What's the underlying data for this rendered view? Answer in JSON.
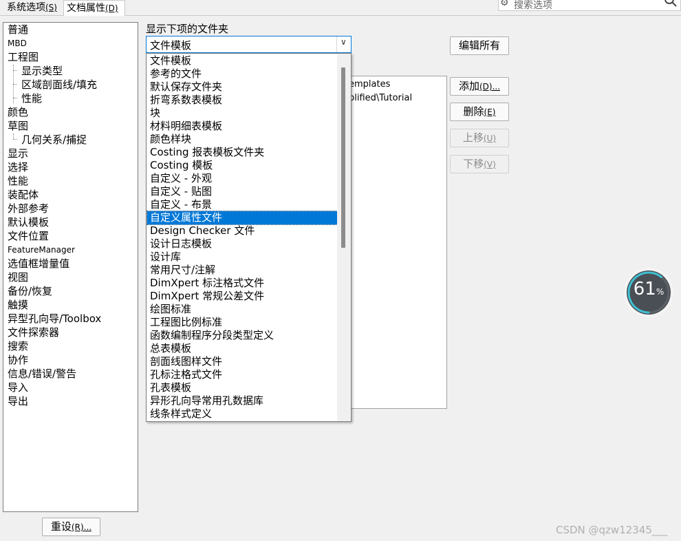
{
  "tabs": [
    {
      "label": "系统选项",
      "accel": "(S)"
    },
    {
      "label": "文档属性",
      "accel": "(D)"
    }
  ],
  "search": {
    "placeholder": "搜索选项"
  },
  "tree": {
    "items": [
      {
        "label": "普通"
      },
      {
        "label": "MBD"
      },
      {
        "label": "工程图"
      },
      {
        "label": "显示类型"
      },
      {
        "label": "区域剖面线/填充"
      },
      {
        "label": "性能"
      },
      {
        "label": "颜色"
      },
      {
        "label": "草图"
      },
      {
        "label": "几何关系/捕捉"
      },
      {
        "label": "显示"
      },
      {
        "label": "选择"
      },
      {
        "label": "性能"
      },
      {
        "label": "装配体"
      },
      {
        "label": "外部参考"
      },
      {
        "label": "默认模板"
      },
      {
        "label": "文件位置"
      },
      {
        "label": "FeatureManager"
      },
      {
        "label": "选值框增量值"
      },
      {
        "label": "视图"
      },
      {
        "label": "备份/恢复"
      },
      {
        "label": "触摸"
      },
      {
        "label": "异型孔向导/Toolbox"
      },
      {
        "label": "文件探索器"
      },
      {
        "label": "搜索"
      },
      {
        "label": "协作"
      },
      {
        "label": "信息/错误/警告"
      },
      {
        "label": "导入"
      },
      {
        "label": "导出"
      }
    ]
  },
  "reset_button": {
    "label": "重设",
    "accel": "(R)..."
  },
  "main": {
    "show_folders_label": "显示下项的文件夹",
    "combo_value": "文件模板",
    "edit_all_label": "编辑所有",
    "path_lines": [
      "emplates",
      "plified\\Tutorial"
    ]
  },
  "buttons": {
    "add": {
      "label": "添加",
      "accel": "(D)..."
    },
    "delete": {
      "label": "删除",
      "accel": "(E)"
    },
    "move_up": {
      "label": "上移",
      "accel": "(U)"
    },
    "move_down": {
      "label": "下移",
      "accel": "(V)"
    }
  },
  "dropdown": {
    "options": [
      "文件模板",
      "参考的文件",
      "默认保存文件夹",
      "折弯系数表模板",
      "块",
      "材料明细表模板",
      "颜色样块",
      "Costing 报表模板文件夹",
      "Costing 模板",
      "自定义 - 外观",
      "自定义 - 贴图",
      "自定义 - 布景",
      "自定义属性文件",
      "Design Checker 文件",
      "设计日志模板",
      "设计库",
      "常用尺寸/注解",
      "DimXpert 标注格式文件",
      "DimXpert 常规公差文件",
      "绘图标准",
      "工程图比例标准",
      "函数编制程序分段类型定义",
      "总表模板",
      "剖面线图样文件",
      "孔标注格式文件",
      "孔表模板",
      "异形孔向导常用孔数据库",
      "线条样式定义"
    ],
    "selected_index": 12
  },
  "gauge": {
    "value": "61",
    "unit": "%",
    "fraction": 0.61
  },
  "watermark": "CSDN @qzw12345___",
  "colors": {
    "accent": "#0078d7",
    "gauge_bg": "#4a4f55",
    "gauge_ring": "#3ec1d3"
  }
}
